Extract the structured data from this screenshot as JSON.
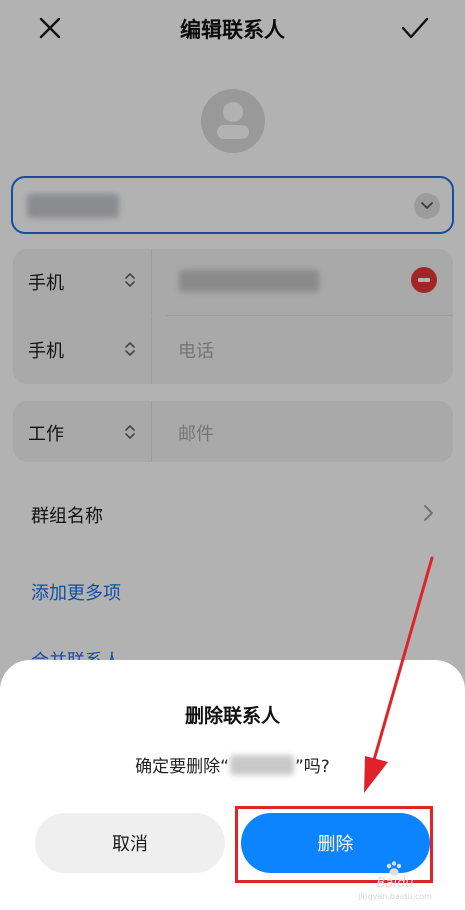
{
  "header": {
    "title": "编辑联系人",
    "close_icon": "close-icon",
    "confirm_icon": "check-icon"
  },
  "avatar": {
    "icon": "person-avatar-icon"
  },
  "name_field": {
    "value_obscured": true,
    "icon": "chevron-down-icon"
  },
  "phones": [
    {
      "type": "手机",
      "value_obscured": true,
      "has_remove": true
    },
    {
      "type": "手机",
      "placeholder": "电话"
    }
  ],
  "emails": [
    {
      "type": "工作",
      "placeholder": "邮件"
    }
  ],
  "group": {
    "label": "群组名称",
    "icon": "chevron-right-icon"
  },
  "links": {
    "add_more": "添加更多项",
    "merge": "合并联系人"
  },
  "dialog": {
    "title": "删除联系人",
    "message_prefix": "确定要删除“",
    "message_suffix": "”吗?",
    "cancel_label": "取消",
    "delete_label": "删除"
  },
  "colors": {
    "accent": "#1a73e8",
    "delete_button": "#0d84ff",
    "remove_icon": "#e53935",
    "annotation": "#e0222a"
  },
  "watermark": {
    "text": "Baidu",
    "url": "jingyan.baidu.com"
  }
}
